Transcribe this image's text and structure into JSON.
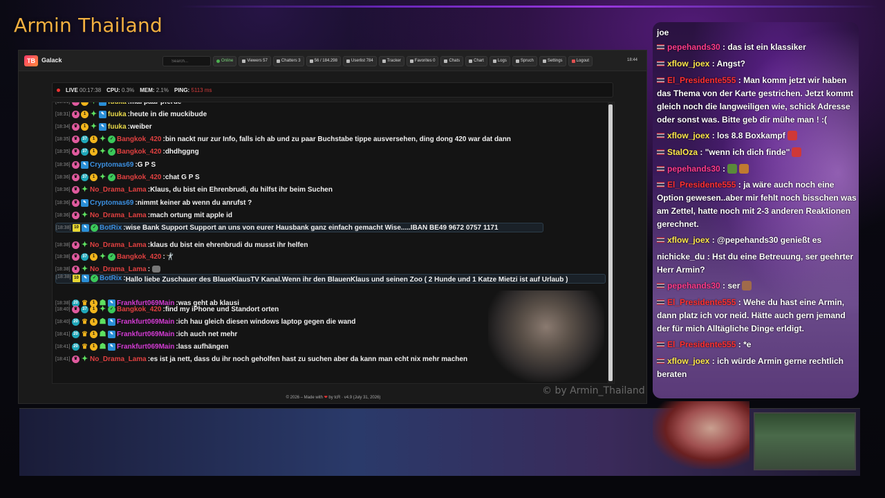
{
  "channel_title": "Armin Thailand",
  "dashboard": {
    "brand": "Galack",
    "logo_text": "TB",
    "search_placeholder": "Search...",
    "nav": [
      {
        "label": "Online"
      },
      {
        "label": "Viewers 57"
      },
      {
        "label": "Chatters 3"
      },
      {
        "label": "56 / 184.298"
      },
      {
        "label": "Userlist 784"
      },
      {
        "label": "Tracker"
      },
      {
        "label": "Favorites 0"
      },
      {
        "label": "Chats"
      },
      {
        "label": "Chart"
      },
      {
        "label": "Logs"
      },
      {
        "label": "Spruch"
      },
      {
        "label": "Settings"
      },
      {
        "label": "Logout"
      }
    ],
    "clock": "18:44",
    "status": {
      "live_label": "LIVE",
      "live_time": "00:17:38",
      "cpu_label": "CPU:",
      "cpu": "0.3%",
      "mem_label": "MEM:",
      "mem": "2.1%",
      "ping_label": "PING:",
      "ping": "5113 ms"
    },
    "messages": [
      {
        "time": "[18:31]",
        "user": "fuuka",
        "text": "mal paar pferde"
      },
      {
        "time": "[18:31]",
        "user": "fuuka",
        "text": "heute in die muckibude"
      },
      {
        "time": "[18:34]",
        "user": "fuuka",
        "text": "weiber"
      },
      {
        "time": "[18:35]",
        "user": "Bangkok_420",
        "text": "bin nackt nur zur Info, falls ich ab und zu paar Buchstabe tippe ausversehen, ding dong 420 war dat dann"
      },
      {
        "time": "[18:35]",
        "user": "Bangkok_420",
        "text": "dhdhggng"
      },
      {
        "time": "[18:36]",
        "user": "Cryptomas69",
        "text": "G P S"
      },
      {
        "time": "[18:36]",
        "user": "Bangkok_420",
        "text": "chat G P S"
      },
      {
        "time": "[18:36]",
        "user": "No_Drama_Lama",
        "text": "Klaus, du bist ein Ehrenbrudi, du hilfst ihr beim Suchen"
      },
      {
        "time": "[18:36]",
        "user": "Cryptomas69",
        "text": "nimmt keiner ab wenn du anrufst ?"
      },
      {
        "time": "[18:36]",
        "user": "No_Drama_Lama",
        "text": "mach ortung mit apple id"
      },
      {
        "time": "[18:38]",
        "user": "BotRix",
        "text": "wise Bank Support Support an uns von eurer Hausbank ganz einfach gemacht Wise.....IBAN BE49 9672 0757 1171"
      },
      {
        "time": "[18:38]",
        "user": "No_Drama_Lama",
        "text": "klaus du bist ein ehrenbrudi du musst ihr helfen"
      },
      {
        "time": "[18:38]",
        "user": "Bangkok_420",
        "text": "🤺"
      },
      {
        "time": "[18:38]",
        "user": "No_Drama_Lama",
        "text": ""
      },
      {
        "time": "[18:38]",
        "user": "BotRix",
        "text": "Hallo liebe Zuschauer des BlaueKlausTV Kanal.Wenn ihr den BlauenKlaus und seinen Zoo ( 2 Hunde und 1 Katze Mietzi ist auf Urlaub ) unterstützen möchtet, wäre das sehr nett von euch Vielen Dank vom BlauenKlaus https://streamelements.com/blaueklaustv/tip"
      },
      {
        "time": "[18:38]",
        "user": "Frankfurt069Main",
        "text": "was geht ab klausi"
      },
      {
        "time": "[18:40]",
        "user": "Bangkok_420",
        "text": "find my iPhone und Standort orten"
      },
      {
        "time": "[18:40]",
        "user": "Frankfurt069Main",
        "text": "ich hau gleich diesen windows laptop gegen die wand"
      },
      {
        "time": "[18:41]",
        "user": "Frankfurt069Main",
        "text": "ich auch net mehr"
      },
      {
        "time": "[18:41]",
        "user": "Frankfurt069Main",
        "text": "lass aufhängen"
      },
      {
        "time": "[18:41]",
        "user": "No_Drama_Lama",
        "text": "es ist ja nett, dass du ihr noch geholfen hast zu suchen aber da kann man echt nix mehr machen"
      }
    ],
    "footer": {
      "left": "© 2026 – Made with",
      "heart": "❤",
      "right": "by tcR · v4.9 (July 31, 2026)"
    }
  },
  "watermark": "© by Armin_Thailand",
  "stream_chat": [
    {
      "user": "",
      "text": "joe",
      "flag": false
    },
    {
      "user": "pepehands30",
      "text": ": das ist ein klassiker",
      "flag": true
    },
    {
      "user": "xflow_joex",
      "text": ": Angst?",
      "flag": true
    },
    {
      "user": "El_Presidente555",
      "text": ": Man komm jetzt wir haben das Thema von der Karte gestrichen. Jetzt kommt gleich noch die langweiligen wie, schick Adresse oder sonst was. Bitte geb dir mühe man ! :(",
      "flag": true
    },
    {
      "user": "xflow_joex",
      "text": ": los 8.8 Boxkampf",
      "flag": true
    },
    {
      "user": "StalOza",
      "text": ": \"wenn ich dich finde\"",
      "flag": true
    },
    {
      "user": "pepehands30",
      "text": ":",
      "flag": true
    },
    {
      "user": "El_Presidente555",
      "text": ": ja wäre auch noch eine Option gewesen..aber mir fehlt noch bisschen was am Zettel, hatte noch mit 2-3 anderen Reaktionen gerechnet.",
      "flag": true
    },
    {
      "user": "xflow_joex",
      "text": ": @pepehands30 genießt es",
      "flag": true
    },
    {
      "user": "nichicke_du",
      "text": ": Hst du eine Betreuung, ser geehrter Herr Armin?",
      "flag": false
    },
    {
      "user": "pepehands30",
      "text": ": ser",
      "flag": true
    },
    {
      "user": "El_Presidente555",
      "text": ": Wehe du hast eine Armin, dann platz ich vor neid. Hätte auch gern jemand der für mich Alltägliche Dinge erldigt.",
      "flag": true
    },
    {
      "user": "El_Presidente555",
      "text": ": *e",
      "flag": true
    },
    {
      "user": "xflow_joex",
      "text": ": ich würde Armin gerne rechtlich beraten",
      "flag": true
    }
  ]
}
